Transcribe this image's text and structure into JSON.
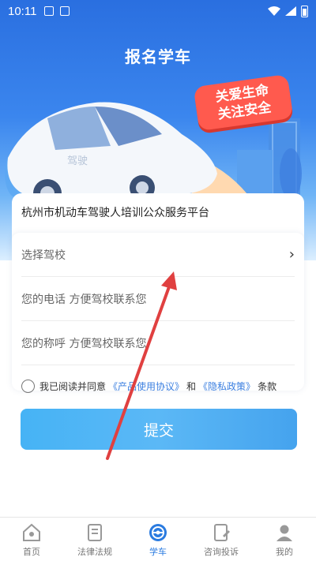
{
  "status_bar": {
    "time": "10:11"
  },
  "header": {
    "title": "报名学车"
  },
  "banner": {
    "line1": "关爱生命",
    "line2": "关注安全"
  },
  "car": {
    "plate_text": "驾驶"
  },
  "card": {
    "platform_title": "杭州市机动车驾驶人培训公众服务平台"
  },
  "form": {
    "school_select": {
      "label": "选择驾校",
      "chevron": "›"
    },
    "phone_field": {
      "placeholder": "您的电话 方便驾校联系您"
    },
    "name_field": {
      "placeholder": "您的称呼 方便驾校联系您"
    }
  },
  "agreement": {
    "prefix": "我已阅读并同意",
    "product_link": "《产品使用协议》",
    "and": "和",
    "privacy_link": "《隐私政策》",
    "suffix": "条款"
  },
  "submit_label": "提交",
  "tabbar": {
    "items": [
      {
        "label": "首页",
        "icon": "home-icon"
      },
      {
        "label": "法律法规",
        "icon": "law-book-icon"
      },
      {
        "label": "学车",
        "icon": "steering-wheel-icon"
      },
      {
        "label": "咨询投诉",
        "icon": "complaint-doc-icon"
      },
      {
        "label": "我的",
        "icon": "profile-icon"
      }
    ],
    "active_index": 2
  },
  "colors": {
    "accent": "#2a7be0",
    "button": "#4fb2f5",
    "banner_red": "#ff5a4e",
    "arrow": "#e04040"
  }
}
